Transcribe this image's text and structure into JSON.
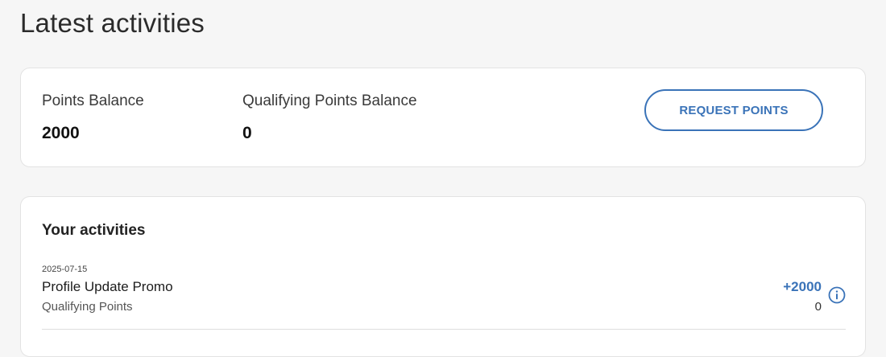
{
  "page": {
    "title": "Latest activities"
  },
  "balance": {
    "points_label": "Points Balance",
    "points_value": "2000",
    "qualifying_label": "Qualifying Points Balance",
    "qualifying_value": "0",
    "request_button_label": "REQUEST POINTS"
  },
  "activities": {
    "title": "Your activities",
    "items": [
      {
        "date": "2025-07-15",
        "name": "Profile Update Promo",
        "type": "Qualifying Points",
        "points": "+2000",
        "qualifying_points": "0",
        "icon": "info-icon"
      }
    ]
  },
  "colors": {
    "accent": "#3a73b8",
    "background": "#f6f6f6",
    "card": "#ffffff"
  }
}
